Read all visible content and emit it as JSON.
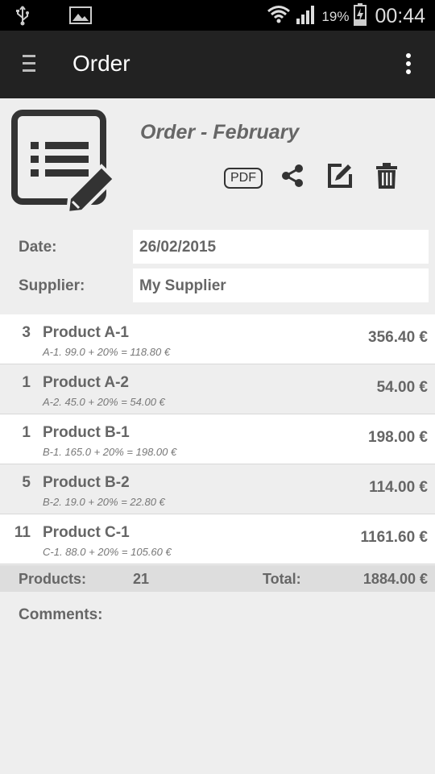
{
  "status_bar": {
    "battery_percent": "19%",
    "time": "00:44"
  },
  "app_bar": {
    "title": "Order"
  },
  "order": {
    "title": "Order - February",
    "pdf_label": "PDF"
  },
  "form": {
    "date_label": "Date:",
    "date_value": "26/02/2015",
    "supplier_label": "Supplier:",
    "supplier_value": "My Supplier"
  },
  "items": [
    {
      "qty": "3",
      "name": "Product A-1",
      "detail": "A-1. 99.0 + 20% = 118.80 €",
      "price": "356.40 €"
    },
    {
      "qty": "1",
      "name": "Product A-2",
      "detail": "A-2. 45.0 + 20% = 54.00 €",
      "price": "54.00 €"
    },
    {
      "qty": "1",
      "name": "Product B-1",
      "detail": "B-1. 165.0 + 20% = 198.00 €",
      "price": "198.00 €"
    },
    {
      "qty": "5",
      "name": "Product B-2",
      "detail": "B-2. 19.0 + 20% = 22.80 €",
      "price": "114.00 €"
    },
    {
      "qty": "11",
      "name": "Product C-1",
      "detail": "C-1. 88.0 + 20% = 105.60 €",
      "price": "1161.60 €"
    }
  ],
  "summary": {
    "products_label": "Products:",
    "products_count": "21",
    "total_label": "Total:",
    "total_value": "1884.00 €"
  },
  "comments_label": "Comments:",
  "colors": {
    "status_bar": "#000000",
    "app_bar": "#222222",
    "background": "#eeeeee",
    "text": "#666666"
  }
}
